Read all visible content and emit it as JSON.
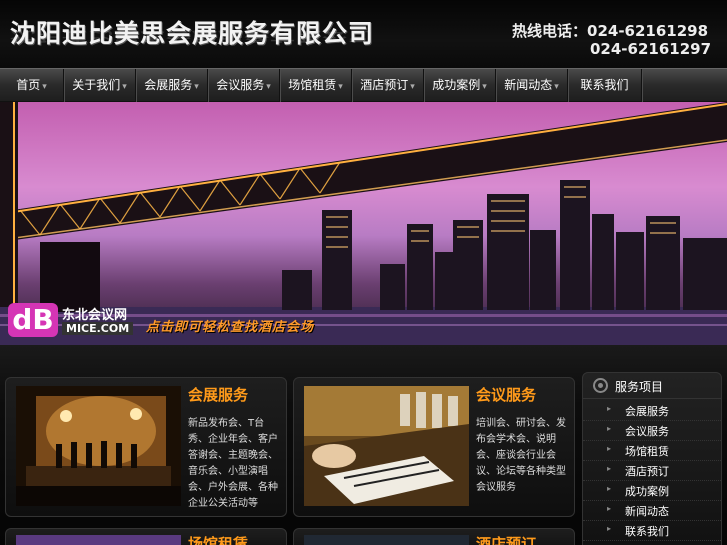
{
  "header": {
    "company": "沈阳迪比美思会展服务有限公司",
    "hotline_label": "热线电话：",
    "phone1": "024-62161298",
    "phone2": "024-62161297"
  },
  "nav": {
    "items": [
      {
        "label": "首页"
      },
      {
        "label": "关于我们"
      },
      {
        "label": "会展服务"
      },
      {
        "label": "会议服务"
      },
      {
        "label": "场馆租赁"
      },
      {
        "label": "酒店预订"
      },
      {
        "label": "成功案例"
      },
      {
        "label": "新闻动态"
      },
      {
        "label": "联系我们"
      }
    ],
    "chevron": "▾"
  },
  "banner": {
    "logo_mark": "dB",
    "logo_text1": "东北会议网",
    "logo_text2": "MICE.COM",
    "slogan": "点击即可轻松查找酒店会场"
  },
  "cards": [
    {
      "title": "会展服务",
      "desc": "新品发布会、T台秀、企业年会、客户答谢会、主题晚会、音乐会、小型演唱会、户外会展、各种企业公关活动等"
    },
    {
      "title": "会议服务",
      "desc": "培训会、研讨会、发布会学术会、说明会、座谈会行业会议、论坛等各种类型会议服务"
    },
    {
      "title": "场馆租赁"
    },
    {
      "title": "酒店预订"
    }
  ],
  "sidebar": {
    "title": "服务项目",
    "items": [
      "会展服务",
      "会议服务",
      "场馆租赁",
      "酒店预订",
      "成功案例",
      "新闻动态",
      "联系我们"
    ],
    "bullet": "▸"
  }
}
